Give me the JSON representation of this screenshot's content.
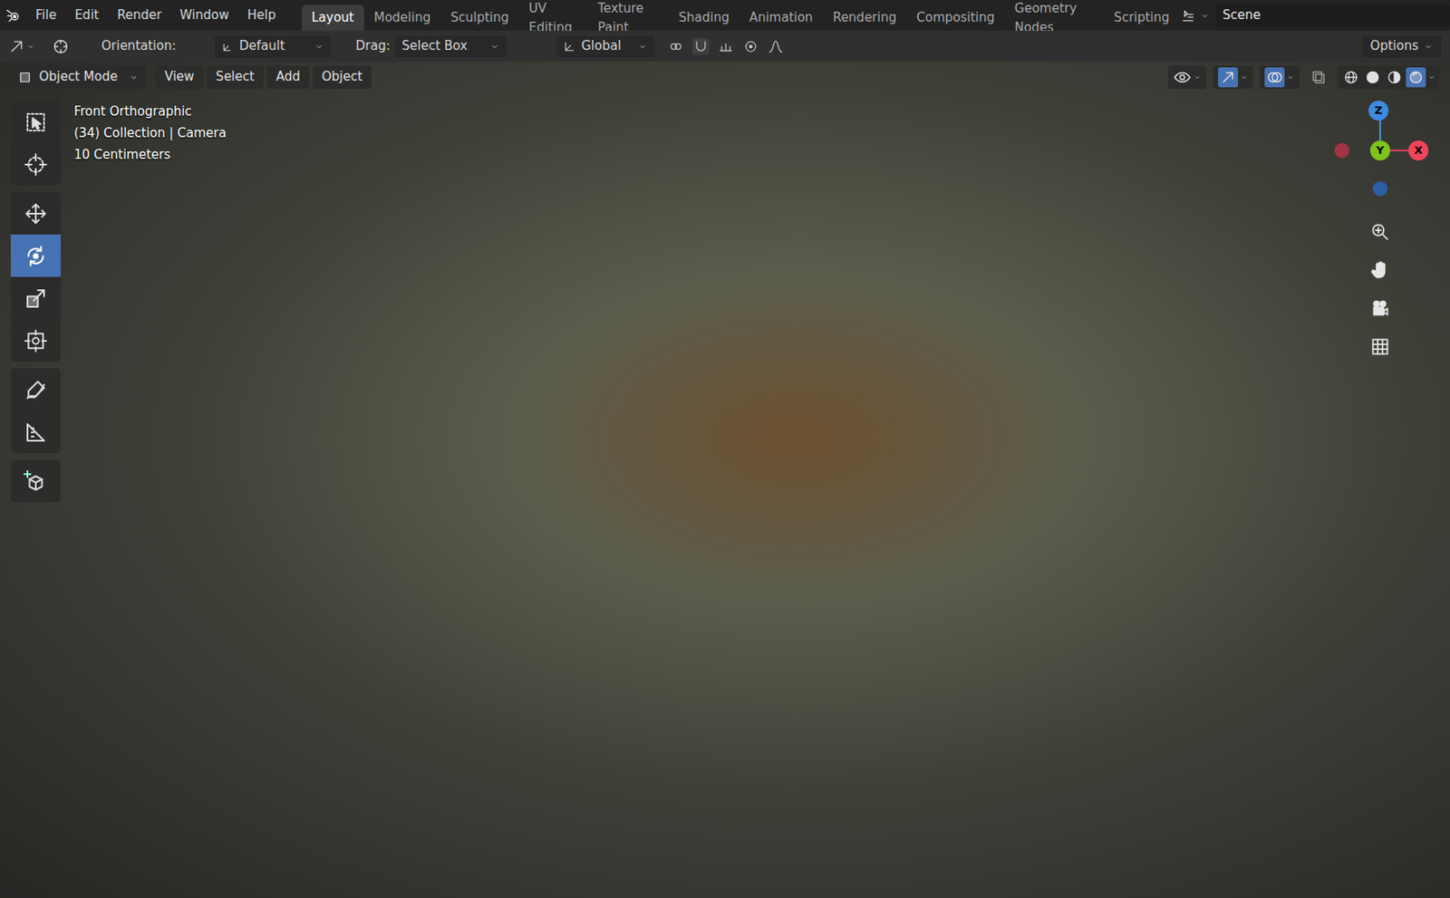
{
  "menus": [
    "File",
    "Edit",
    "Render",
    "Window",
    "Help"
  ],
  "workspaces": [
    {
      "label": "Layout",
      "selected": true
    },
    {
      "label": "Modeling",
      "selected": false
    },
    {
      "label": "Sculpting",
      "selected": false
    },
    {
      "label": "UV Editing",
      "selected": false
    },
    {
      "label": "Texture Paint",
      "selected": false
    },
    {
      "label": "Shading",
      "selected": false
    },
    {
      "label": "Animation",
      "selected": false
    },
    {
      "label": "Rendering",
      "selected": false
    },
    {
      "label": "Compositing",
      "selected": false
    },
    {
      "label": "Geometry Nodes",
      "selected": false
    },
    {
      "label": "Scripting",
      "selected": false
    }
  ],
  "scene": "Scene",
  "tool_header": {
    "orientation_label": "Orientation:",
    "orientation": "Default",
    "drag_label": "Drag:",
    "drag": "Select Box",
    "transform": "Global",
    "options": "Options"
  },
  "viewport_header": {
    "mode": "Object Mode",
    "menus": [
      "View",
      "Select",
      "Add",
      "Object"
    ]
  },
  "overlay": {
    "lines": [
      "Front Orthographic",
      "(34) Collection | Camera",
      "10 Centimeters"
    ]
  },
  "tools": [
    {
      "kind": "select",
      "selected": false
    },
    {
      "kind": "cursor",
      "selected": false
    },
    {
      "kind": "move",
      "selected": false
    },
    {
      "kind": "rotate",
      "selected": true
    },
    {
      "kind": "scale",
      "selected": false
    },
    {
      "kind": "transform",
      "selected": false
    },
    {
      "kind": "annotate",
      "selected": false
    },
    {
      "kind": "measure",
      "selected": false
    },
    {
      "kind": "add-cube",
      "selected": false
    }
  ],
  "gizmo": {
    "z": "Z",
    "y": "Y",
    "x": "X"
  },
  "shading": [
    {
      "kind": "wireframe",
      "selected": false
    },
    {
      "kind": "solid",
      "selected": false
    },
    {
      "kind": "material",
      "selected": false
    },
    {
      "kind": "rendered",
      "selected": true
    }
  ]
}
